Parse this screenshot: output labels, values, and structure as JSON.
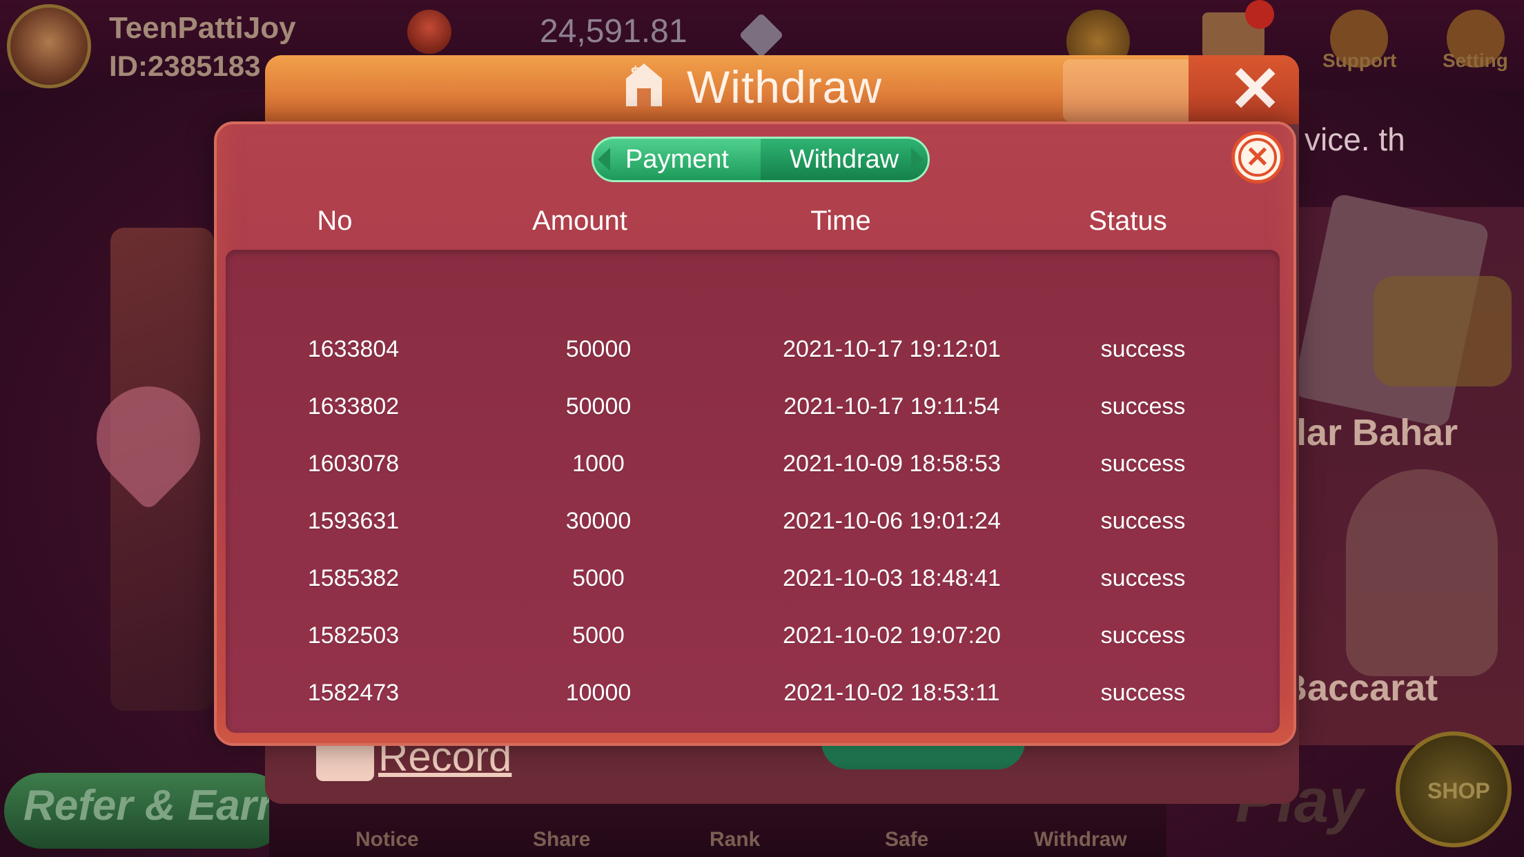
{
  "top_bar": {
    "username": "TeenPattiJoy",
    "user_id": "ID:2385183",
    "balance": "24,591.81",
    "support_label": "Support",
    "setting_label": "Setting"
  },
  "background": {
    "refer_earn": "Refer & Earn",
    "marquee_text": "vice. th",
    "game_andar": "dar Bahar",
    "game_baccarat": "Baccarat",
    "play_text": "Play",
    "shop_label": "SHOP",
    "nav": [
      "Notice",
      "Share",
      "Rank",
      "Safe",
      "Withdraw"
    ]
  },
  "withdraw_panel": {
    "title": "Withdraw",
    "record_label": "Record"
  },
  "dialog": {
    "tabs": [
      {
        "label": "Payment",
        "active": false
      },
      {
        "label": "Withdraw",
        "active": true
      }
    ],
    "columns": [
      "No",
      "Amount",
      "Time",
      "Status"
    ],
    "rows": [
      {
        "no": "1633804",
        "amount": "50000",
        "time": "2021-10-17 19:12:01",
        "status": "success"
      },
      {
        "no": "1633802",
        "amount": "50000",
        "time": "2021-10-17 19:11:54",
        "status": "success"
      },
      {
        "no": "1603078",
        "amount": "1000",
        "time": "2021-10-09 18:58:53",
        "status": "success"
      },
      {
        "no": "1593631",
        "amount": "30000",
        "time": "2021-10-06 19:01:24",
        "status": "success"
      },
      {
        "no": "1585382",
        "amount": "5000",
        "time": "2021-10-03 18:48:41",
        "status": "success"
      },
      {
        "no": "1582503",
        "amount": "5000",
        "time": "2021-10-02 19:07:20",
        "status": "success"
      },
      {
        "no": "1582473",
        "amount": "10000",
        "time": "2021-10-02 18:53:11",
        "status": "success"
      }
    ]
  },
  "colors": {
    "accent_green": "#1d9a5a",
    "dialog_red": "#b2424c",
    "close_orange": "#e0502d"
  }
}
